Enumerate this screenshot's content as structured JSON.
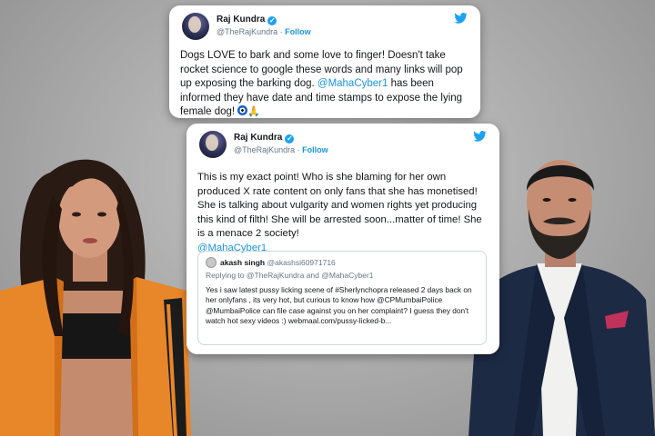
{
  "tweet1": {
    "name": "Raj Kundra",
    "handle": "@TheRajKundra",
    "follow": "Follow",
    "text_before": "Dogs LOVE to bark and some love to finger! Doesn't take rocket science to google these words and many links will pop up exposing the barking dog. ",
    "mention": "@MahaCyber1",
    "text_after": " has been informed they have date and time stamps to expose the lying female dog! ",
    "pray": "🙏"
  },
  "tweet2": {
    "name": "Raj Kundra",
    "handle": "@TheRajKundra",
    "follow": "Follow",
    "text": "This is my exact point! Who is she blaming for her own produced X rate content on only fans that she has monetised! She is talking about vulgarity and women rights yet producing this kind of filth! She will be arrested soon...matter of time! She is a menace 2 society!",
    "mention": "@MahaCyber1"
  },
  "quote": {
    "name": "akash singh",
    "handle": "@akashsi60971716",
    "replying_to": "Replying to @TheRajKundra and @MahaCyber1",
    "text": "Yes i saw latest pussy licking scene of #Sherlynchopra released 2 days back on her onlyfans , its very hot, but curious to know how @CPMumbaiPolice @MumbaiPolice can file case against you on her complaint? I guess they don't watch hot sexy videos :) webmaal.com/pussy-licked-b..."
  },
  "colors": {
    "twitter_blue": "#1da1f2",
    "link_blue": "#1b95e0",
    "background_gray": "#a9a9a9"
  },
  "icons": [
    "twitter-bird-icon",
    "verified-badge-icon",
    "nazar-eye-emoji",
    "folded-hands-emoji"
  ]
}
